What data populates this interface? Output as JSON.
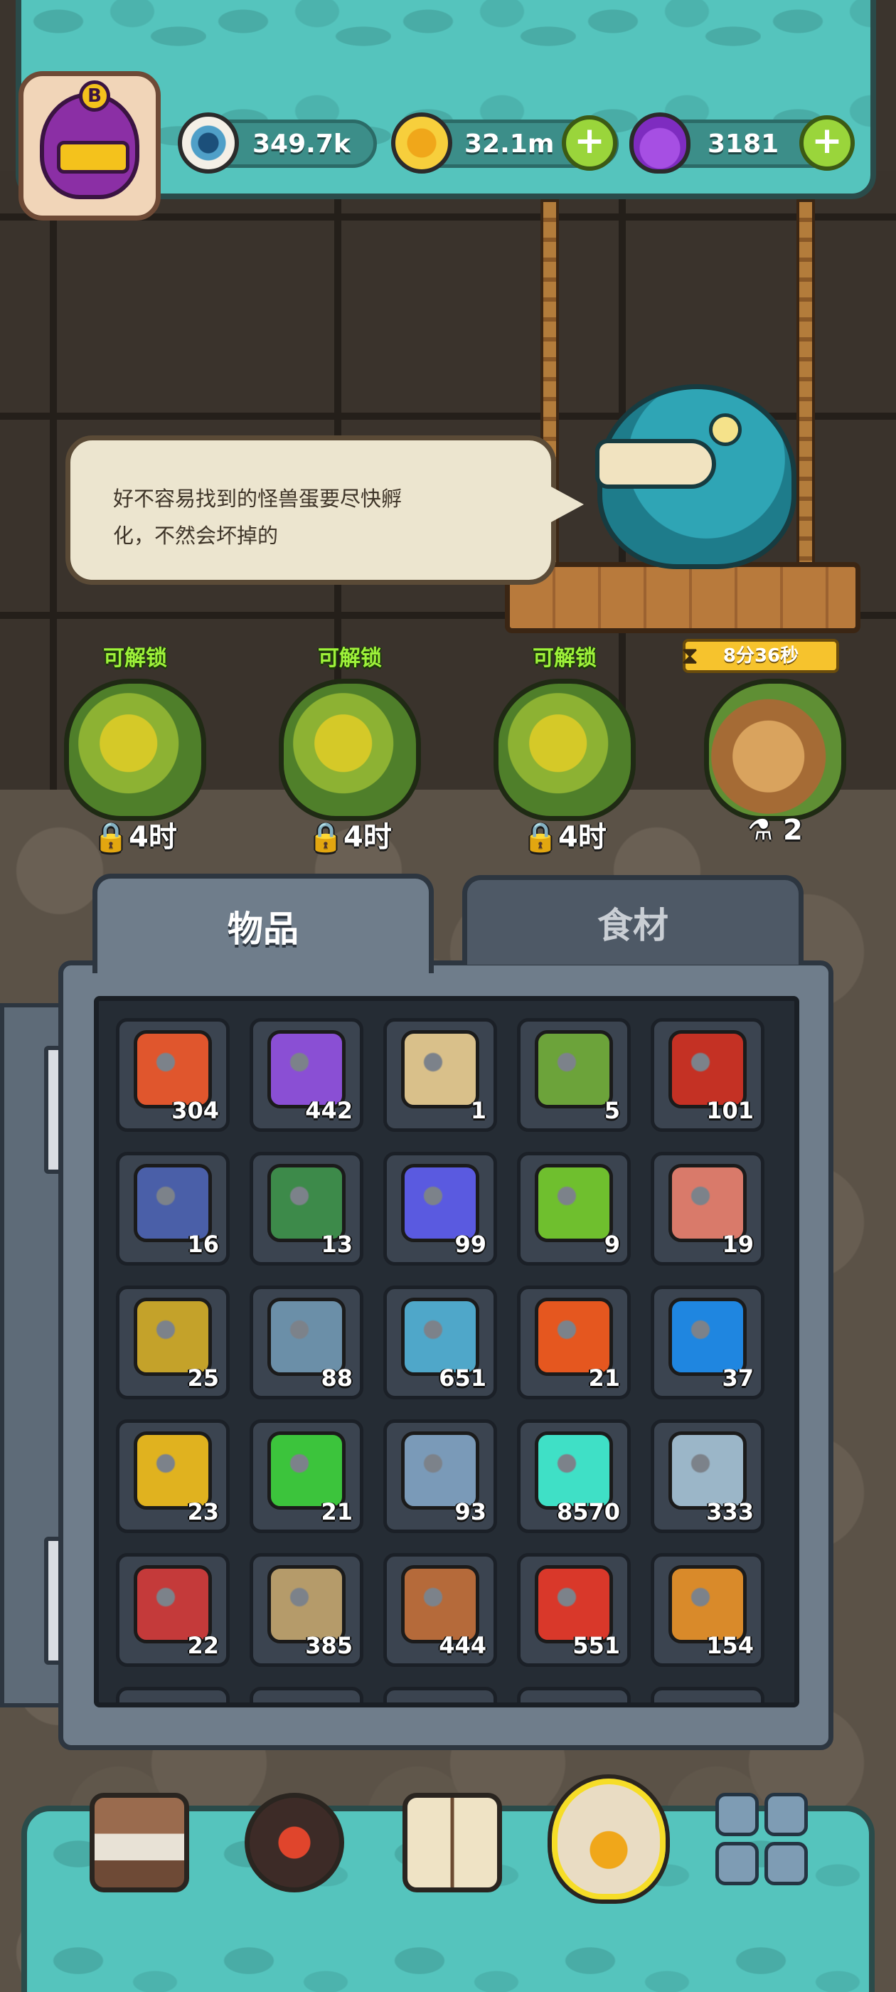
{
  "resources": {
    "eyes": {
      "icon": "eyeball-icon",
      "value": "349.7k"
    },
    "coins": {
      "icon": "coin-icon",
      "value": "32.1m"
    },
    "potions": {
      "icon": "potion-icon",
      "value": "3181"
    }
  },
  "player": {
    "rank_badge": "B"
  },
  "dialog": {
    "line1": "好不容易找到的怪兽蛋要尽快孵",
    "line2": "化，不然会坏掉的"
  },
  "eggs": [
    {
      "status": "可解锁",
      "footer": "4时",
      "footer_icon": "lock-icon"
    },
    {
      "status": "可解锁",
      "footer": "4时",
      "footer_icon": "lock-icon"
    },
    {
      "status": "可解锁",
      "footer": "4时",
      "footer_icon": "lock-icon"
    },
    {
      "status": "",
      "timer": "8分36秒",
      "footer": "2",
      "footer_icon": "potion-icon"
    }
  ],
  "tabs": [
    {
      "label": "物品",
      "active": true
    },
    {
      "label": "食材",
      "active": false
    }
  ],
  "inventory": [
    {
      "icon": "meat-bone-icon",
      "qty": "304",
      "color": "#e0562d"
    },
    {
      "icon": "purple-dust-icon",
      "qty": "442",
      "color": "#8a4fd4"
    },
    {
      "icon": "parchment-icon",
      "qty": "1",
      "color": "#d9c08a"
    },
    {
      "icon": "video-ticket-icon",
      "qty": "5",
      "color": "#6ca33a"
    },
    {
      "icon": "oil-barrel-icon",
      "qty": "101",
      "color": "#c43124"
    },
    {
      "icon": "card-pack-icon",
      "qty": "16",
      "color": "#4a5fa8"
    },
    {
      "icon": "forest-card-icon",
      "qty": "13",
      "color": "#3d8a4a"
    },
    {
      "icon": "crystal-cluster-icon",
      "qty": "99",
      "color": "#5a5ae0"
    },
    {
      "icon": "green-ore-icon",
      "qty": "9",
      "color": "#6fbf2e"
    },
    {
      "icon": "map-scroll-icon",
      "qty": "19",
      "color": "#d97a6a"
    },
    {
      "icon": "tarot-card-icon",
      "qty": "25",
      "color": "#c4a22a"
    },
    {
      "icon": "soot-wheel-icon",
      "qty": "88",
      "color": "#6b8fa8"
    },
    {
      "icon": "blue-fish-icon",
      "qty": "651",
      "color": "#4fa7c9"
    },
    {
      "icon": "orange-gem-icon",
      "qty": "21",
      "color": "#e5571f"
    },
    {
      "icon": "blue-gem-icon",
      "qty": "37",
      "color": "#1f86e0"
    },
    {
      "icon": "yellow-gem-icon",
      "qty": "23",
      "color": "#e0b21f"
    },
    {
      "icon": "green-gem-icon",
      "qty": "21",
      "color": "#3cc43c"
    },
    {
      "icon": "tool-bundle-icon",
      "qty": "93",
      "color": "#7a9ab8"
    },
    {
      "icon": "spirit-smoke-icon",
      "qty": "8570",
      "color": "#3fe0c6"
    },
    {
      "icon": "soot-necklace-icon",
      "qty": "333",
      "color": "#9bb6c8"
    },
    {
      "icon": "tin-can-icon",
      "qty": "22",
      "color": "#c43a3a"
    },
    {
      "icon": "eye-stalk-icon",
      "qty": "385",
      "color": "#b59b6a"
    },
    {
      "icon": "lute-icon",
      "qty": "444",
      "color": "#b56a3a"
    },
    {
      "icon": "red-urchin-icon",
      "qty": "551",
      "color": "#d9382a"
    },
    {
      "icon": "feather-icon",
      "qty": "154",
      "color": "#d98a2a"
    }
  ],
  "nav": [
    {
      "icon": "shop-building-icon"
    },
    {
      "icon": "monster-lair-icon"
    },
    {
      "icon": "recipe-book-icon"
    },
    {
      "icon": "coin-bag-icon",
      "active": true
    },
    {
      "icon": "menu-grid-icon"
    }
  ]
}
